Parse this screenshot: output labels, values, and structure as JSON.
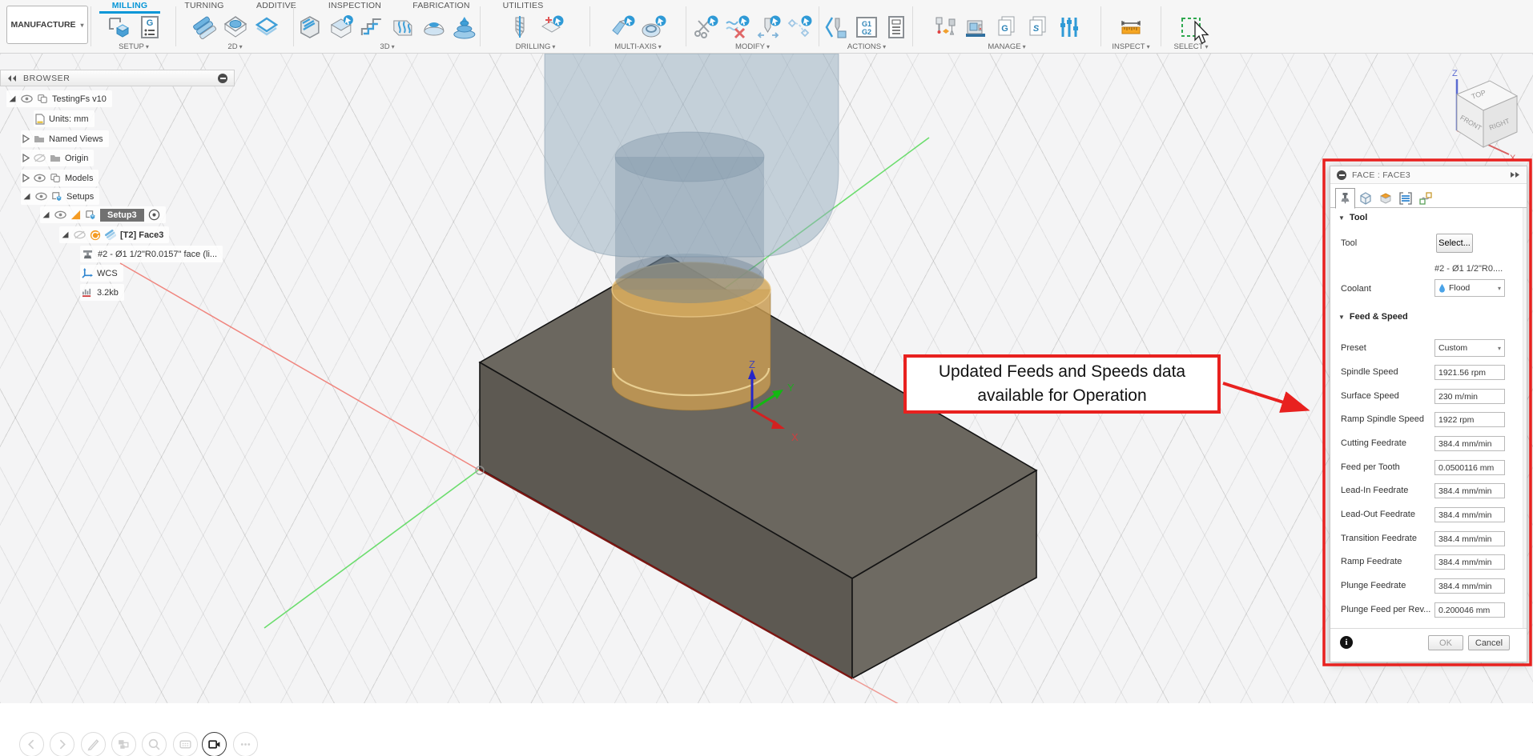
{
  "workspace_button": "MANUFACTURE",
  "ribbon_tabs": [
    {
      "label": "MILLING",
      "active": true
    },
    {
      "label": "TURNING",
      "active": false
    },
    {
      "label": "ADDITIVE",
      "active": false
    },
    {
      "label": "INSPECTION",
      "active": false
    },
    {
      "label": "FABRICATION",
      "active": false
    },
    {
      "label": "UTILITIES",
      "active": false
    }
  ],
  "toolbar_groups": [
    {
      "label": "SETUP",
      "icons": [
        "new-setup-icon",
        "gcode-document-icon"
      ]
    },
    {
      "label": "2D",
      "icons": [
        "face-2d-icon",
        "pocket-2d-icon",
        "contour-2d-icon"
      ]
    },
    {
      "label": "3D",
      "icons": [
        "adaptive-clearing-icon",
        "pocket-clearing-icon",
        "steep-shallow-icon",
        "parallel-icon",
        "scallop-icon",
        "spiral-icon"
      ]
    },
    {
      "label": "DRILLING",
      "icons": [
        "drill-icon",
        "hole-recognition-icon"
      ]
    },
    {
      "label": "MULTI-AXIS",
      "icons": [
        "swarf-icon",
        "multi-axis-contour-icon"
      ]
    },
    {
      "label": "MODIFY",
      "icons": [
        "trim-toolpath-icon",
        "delete-passes-icon",
        "feed-optimization-icon",
        "edit-links-icon"
      ]
    },
    {
      "label": "ACTIONS",
      "icons": [
        "simulate-icon",
        "post-process-icon",
        "setup-sheet-icon"
      ]
    },
    {
      "label": "MANAGE",
      "icons": [
        "probe-icon",
        "machine-library-icon",
        "post-library-icon",
        "template-library-icon",
        "tool-library-icon"
      ]
    },
    {
      "label": "INSPECT",
      "icons": [
        "measure-icon"
      ]
    },
    {
      "label": "SELECT",
      "icons": [
        "window-selection-icon"
      ]
    }
  ],
  "icons": {
    "gcode_g": "G",
    "post_g1": "G1",
    "post_g2": "G2",
    "lib_g": "G",
    "lib_s": "S"
  },
  "browser": {
    "title": "BROWSER",
    "items": [
      {
        "label": "TestingFs v10"
      },
      {
        "label": "Units: mm"
      },
      {
        "label": "Named Views"
      },
      {
        "label": "Origin"
      },
      {
        "label": "Models"
      },
      {
        "label": "Setups"
      },
      {
        "label": "Setup3"
      },
      {
        "label": "[T2] Face3"
      },
      {
        "label": "#2 - Ø1 1/2\"R0.0157\" face (li..."
      },
      {
        "label": "WCS"
      },
      {
        "label": "3.2kb"
      }
    ]
  },
  "viewcube": {
    "top": "TOP",
    "front": "FRONT",
    "right": "RIGHT",
    "axis_z": "Z",
    "axis_x": "X"
  },
  "triad": {
    "x": "X",
    "y": "Y",
    "z": "Z"
  },
  "dialog": {
    "title": "FACE : FACE3",
    "tool_section": {
      "header": "Tool",
      "tool_label": "Tool",
      "tool_button": "Select...",
      "tool_name": "#2 - Ø1 1/2\"R0....",
      "coolant_label": "Coolant",
      "coolant_value": "Flood"
    },
    "feed_section": {
      "header": "Feed & Speed",
      "preset_label": "Preset",
      "preset_value": "Custom",
      "rows": [
        {
          "label": "Spindle Speed",
          "value": "1921.56 rpm"
        },
        {
          "label": "Surface Speed",
          "value": "230 m/min"
        },
        {
          "label": "Ramp Spindle Speed",
          "value": "1922 rpm"
        },
        {
          "label": "Cutting Feedrate",
          "value": "384.4 mm/min"
        },
        {
          "label": "Feed per Tooth",
          "value": "0.0500116 mm"
        },
        {
          "label": "Lead-In Feedrate",
          "value": "384.4 mm/min"
        },
        {
          "label": "Lead-Out Feedrate",
          "value": "384.4 mm/min"
        },
        {
          "label": "Transition Feedrate",
          "value": "384.4 mm/min"
        },
        {
          "label": "Ramp Feedrate",
          "value": "384.4 mm/min"
        },
        {
          "label": "Plunge Feedrate",
          "value": "384.4 mm/min"
        },
        {
          "label": "Plunge Feed per Rev...",
          "value": "0.200046 mm"
        }
      ]
    },
    "ok": "OK",
    "cancel": "Cancel"
  },
  "annotation": {
    "line1": "Updated Feeds and Speeds data",
    "line2": "available for Operation"
  },
  "bottom_bar": {
    "icons": [
      "previous-view-icon",
      "next-view-icon",
      "marking-menu-icon",
      "display-settings-icon",
      "zoom-icon",
      "pan-icon",
      "orbit-camera-icon",
      "more-options-icon"
    ]
  },
  "colors": {
    "accent_blue": "#0696d7",
    "annotation_red": "#e8211f",
    "stock_gray": "#6b675f",
    "tool_gold": "#c79b52",
    "holder_blue": "#94acbe"
  }
}
